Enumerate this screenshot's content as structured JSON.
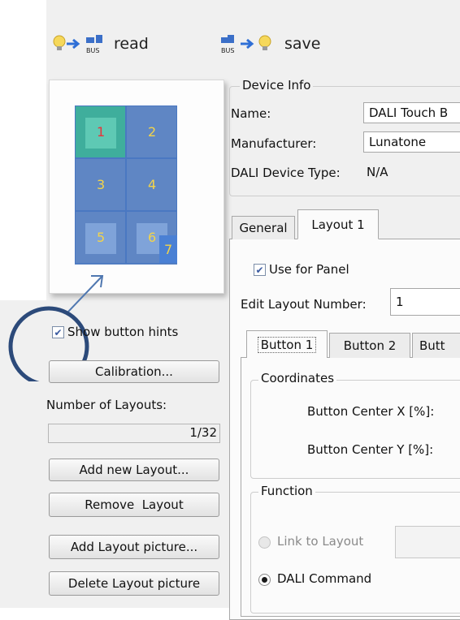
{
  "toolbar": {
    "read_label": "read",
    "save_label": "save",
    "bus_text": "BUS"
  },
  "preview": {
    "cells": [
      {
        "label": "1"
      },
      {
        "label": "2"
      },
      {
        "label": "3"
      },
      {
        "label": "4"
      },
      {
        "label": "5"
      },
      {
        "label": "6"
      }
    ],
    "extra_label": "7"
  },
  "left_panel": {
    "show_hints_label": "Show button hints",
    "show_hints_checked": true,
    "calibration_label": "Calibration...",
    "layouts_heading": "Number of Layouts:",
    "layouts_value": "1/32",
    "add_layout_label": "Add new Layout...",
    "remove_layout_label": "Remove  Layout",
    "add_picture_label": "Add Layout picture...",
    "delete_picture_label": "Delete Layout picture"
  },
  "device_info": {
    "title": "Device Info",
    "name_label": "Name:",
    "name_value": "DALI Touch B",
    "manufacturer_label": "Manufacturer:",
    "manufacturer_value": "Lunatone",
    "type_label": "DALI Device Type:",
    "type_value": "N/A"
  },
  "tabs": {
    "general": "General",
    "layout1": "Layout 1"
  },
  "layout_tab": {
    "use_panel_label": "Use for Panel",
    "use_panel_checked": true,
    "edit_layout_label": "Edit Layout Number:",
    "edit_layout_value": "1",
    "button_tabs": [
      "Button 1",
      "Button 2",
      "Butt"
    ],
    "coordinates_title": "Coordinates",
    "center_x_label": "Button Center X [%]:",
    "center_y_label": "Button Center Y [%]:",
    "function_title": "Function",
    "link_layout_label": "Link to Layout",
    "dali_command_label": "DALI Command"
  },
  "colors": {
    "accent": "#3d5a8a",
    "cell": "#5f86c4",
    "selected_cell": "#3fae9c"
  }
}
